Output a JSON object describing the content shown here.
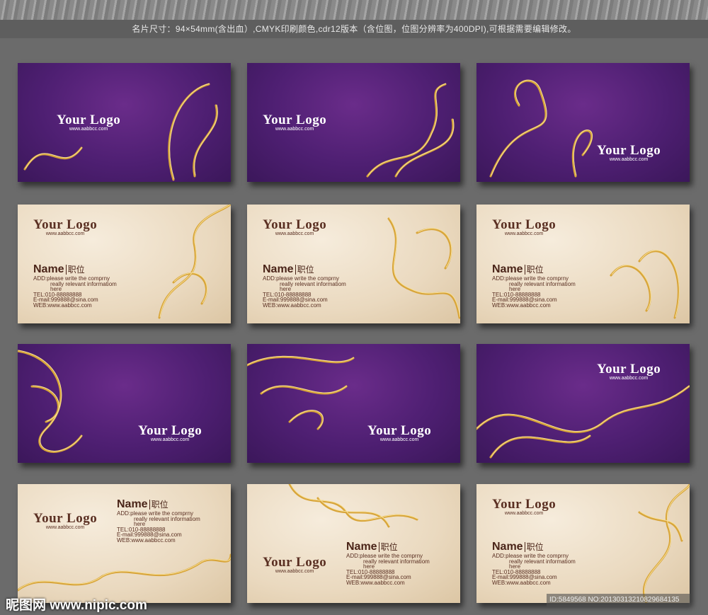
{
  "header": {
    "description": "名片尺寸：94×54mm(含出血）,CMYK印刷颜色,cdr12版本（含位图，位图分辨率为400DPI),可根据需要编辑修改。"
  },
  "card_text": {
    "logo": "Your Logo",
    "url": "www.aabbcc.com",
    "name": "Name",
    "position": "职位",
    "add": "ADD:please write the comprny",
    "add2": "really relevant informatiom",
    "add3": "here",
    "tel": "TEL:010-88888888",
    "email": "E-mail:999888@sina.com",
    "web": "WEB:www.aabbcc.com"
  },
  "cards": [
    {
      "theme": "purple"
    },
    {
      "theme": "purple"
    },
    {
      "theme": "purple"
    },
    {
      "theme": "beige"
    },
    {
      "theme": "beige"
    },
    {
      "theme": "beige"
    },
    {
      "theme": "purple"
    },
    {
      "theme": "purple"
    },
    {
      "theme": "purple"
    },
    {
      "theme": "beige"
    },
    {
      "theme": "beige"
    },
    {
      "theme": "beige"
    }
  ],
  "colors": {
    "gold": "#d8a53a",
    "purple": "#4e1f72",
    "beige": "#ead9bf",
    "text": "#5a2f22"
  },
  "watermark": {
    "site": "昵图网 www.nipic.com",
    "id": "ID:5849568 NO:20130313210829684135"
  }
}
